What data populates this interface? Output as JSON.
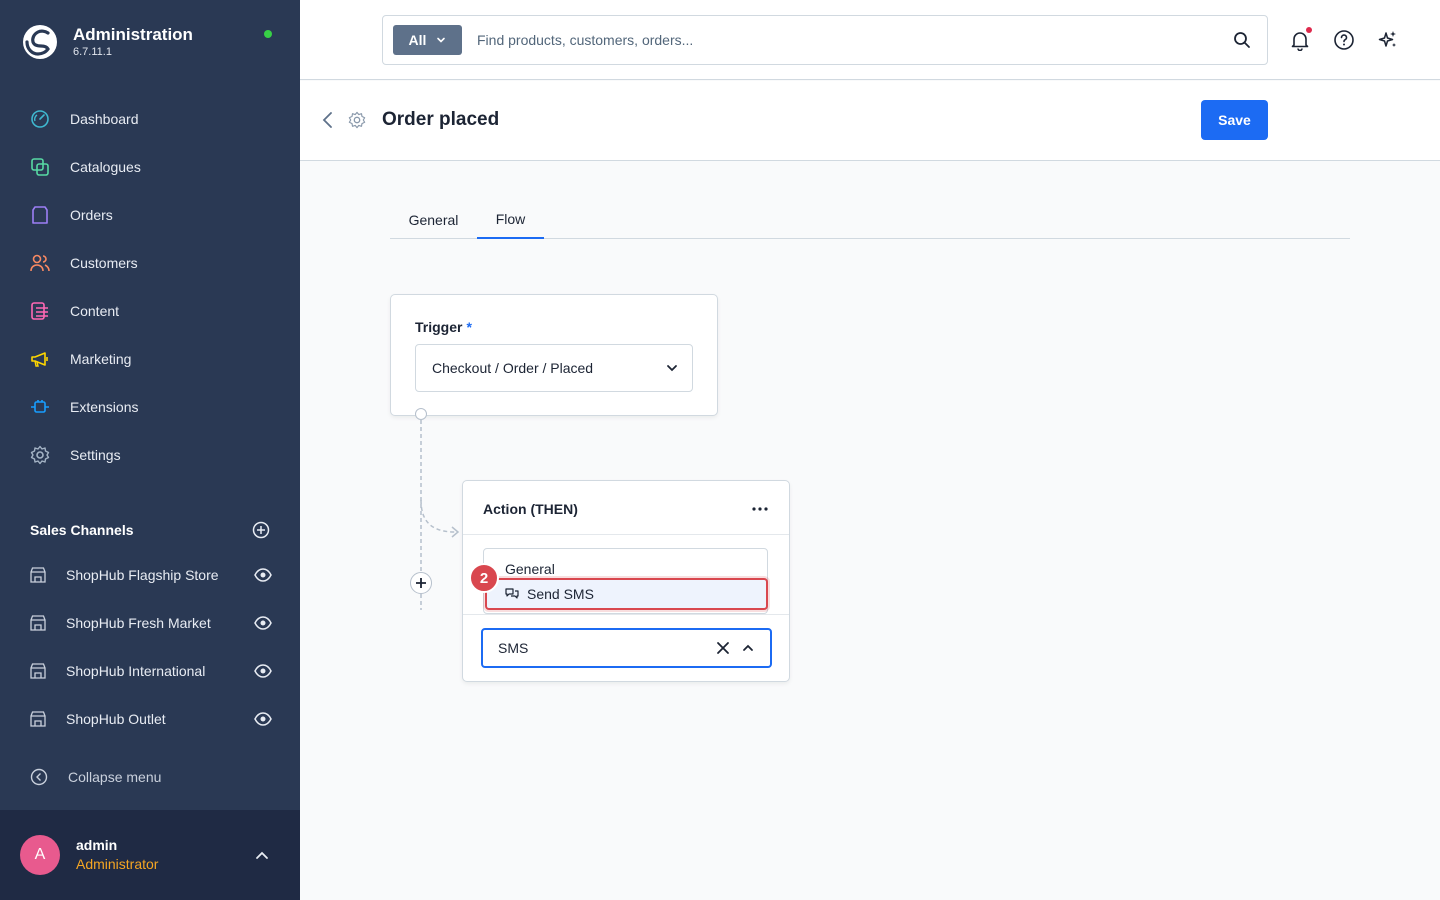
{
  "app": {
    "title": "Administration",
    "version": "6.7.11.1"
  },
  "sidebar": {
    "items": [
      {
        "label": "Dashboard",
        "icon": "dashboard-icon",
        "color": "#3fb8d0"
      },
      {
        "label": "Catalogues",
        "icon": "catalogue-icon",
        "color": "#57d9a3"
      },
      {
        "label": "Orders",
        "icon": "orders-bag-icon",
        "color": "#9c7ff5"
      },
      {
        "label": "Customers",
        "icon": "customers-icon",
        "color": "#f88962"
      },
      {
        "label": "Content",
        "icon": "content-icon",
        "color": "#ff68b4"
      },
      {
        "label": "Marketing",
        "icon": "marketing-megaphone-icon",
        "color": "#ffd700"
      },
      {
        "label": "Extensions",
        "icon": "extensions-plug-icon",
        "color": "#189eff"
      },
      {
        "label": "Settings",
        "icon": "settings-gear-icon",
        "color": "#a4b3c5"
      }
    ],
    "sales_channels": {
      "title": "Sales Channels",
      "items": [
        {
          "label": "ShopHub Flagship Store"
        },
        {
          "label": "ShopHub Fresh Market"
        },
        {
          "label": "ShopHub International"
        },
        {
          "label": "ShopHub Outlet"
        }
      ]
    },
    "collapse_label": "Collapse menu",
    "user": {
      "initial": "A",
      "name": "admin",
      "role": "Administrator"
    }
  },
  "search": {
    "type_label": "All",
    "placeholder": "Find products, customers, orders..."
  },
  "page": {
    "title": "Order placed",
    "save_label": "Save"
  },
  "tabs": [
    {
      "label": "General",
      "active": false
    },
    {
      "label": "Flow",
      "active": true
    }
  ],
  "trigger": {
    "label": "Trigger",
    "required_mark": "*",
    "value": "Checkout / Order / Placed"
  },
  "action": {
    "title": "Action (THEN)",
    "dropdown_group": "General",
    "highlighted_option": "Send SMS",
    "step_badge": "2",
    "search_value": "SMS"
  },
  "colors": {
    "sidebar_bg": "#2a3954",
    "accent": "#1c6bf3",
    "highlight_red": "#d9474f",
    "status_online": "#37d046"
  }
}
